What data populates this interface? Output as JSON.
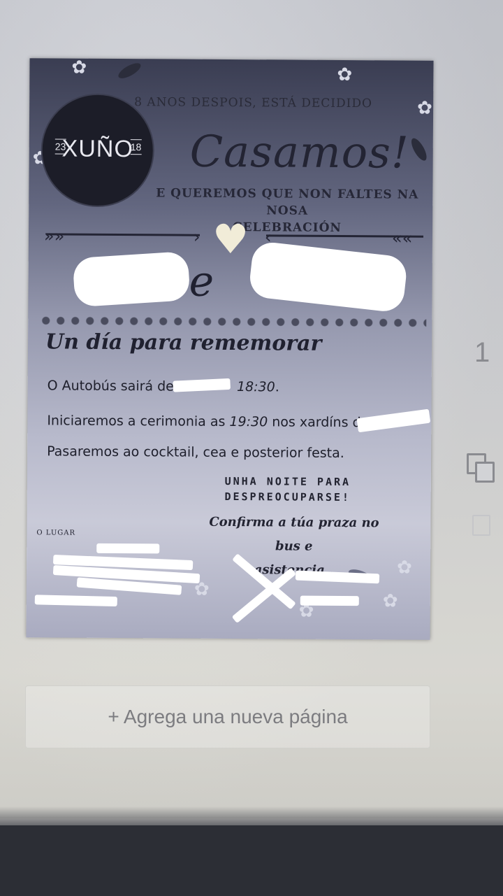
{
  "invitation": {
    "tagline_top": "8 ANOS DESPOIS, ESTÁ DECIDIDO",
    "date_day": "23",
    "date_month": "XUÑO",
    "date_year": "18",
    "headline": "Casamos!",
    "subtitle_line1": "E QUEREMOS QUE NON FALTES NA NOSA",
    "subtitle_line2": "CELEBRACIÓN",
    "names_connector": "e",
    "section_title": "Un día para rememorar",
    "bus_prefix": "O Autobús sairá de",
    "bus_time": "18:30",
    "bus_suffix": ".",
    "ceremony_prefix": "Iniciaremos a cerimonia as",
    "ceremony_time": "19:30",
    "ceremony_suffix": "nos xardíns de",
    "party_line": "Pasaremos ao cocktail, cea e posterior festa.",
    "cta_line1": "UNHA NOITE PARA",
    "cta_line2": "DESPREOCUPARSE!",
    "confirm_line1": "Confirma a túa praza no bus e",
    "confirm_line2": "asistencia..",
    "venue_label": "O LUGAR"
  },
  "editor": {
    "add_page_label": "+ Agrega una nueva página",
    "page_number": "1",
    "duplicate_icon": "duplicate-icon"
  },
  "colors": {
    "invitation_dark": "#1c1d28",
    "invitation_light": "#c9cad8",
    "heart": "#f1ecd8"
  }
}
